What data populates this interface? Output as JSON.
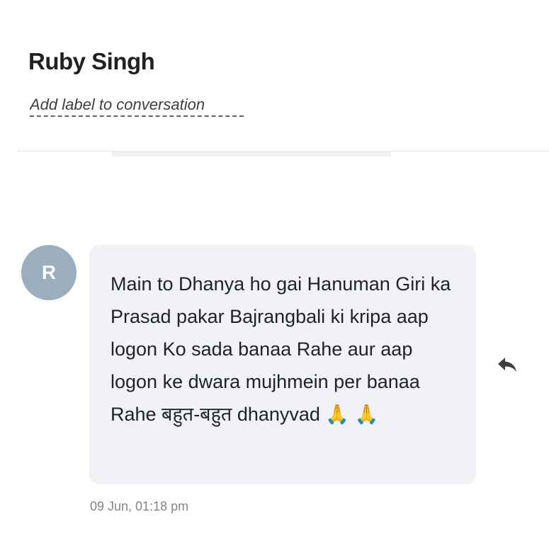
{
  "conversation": {
    "contact_name": "Ruby Singh",
    "label_placeholder": "Add label to conversation"
  },
  "message": {
    "avatar_initial": "R",
    "text": "Main to Dhanya ho gai Hanuman Giri ka Prasad pakar Bajrangbali ki kripa aap logon Ko sada banaa Rahe aur aap logon ke dwara mujhmein per banaa Rahe बहुत-बहुत dhanyvad 🙏 🙏",
    "timestamp": "09 Jun, 01:18 pm",
    "reply_icon": "reply-icon"
  },
  "colors": {
    "avatar_bg": "#9aaebe",
    "bubble_bg": "#f0f2f5",
    "text": "#1f2326",
    "timestamp": "#80868b"
  }
}
